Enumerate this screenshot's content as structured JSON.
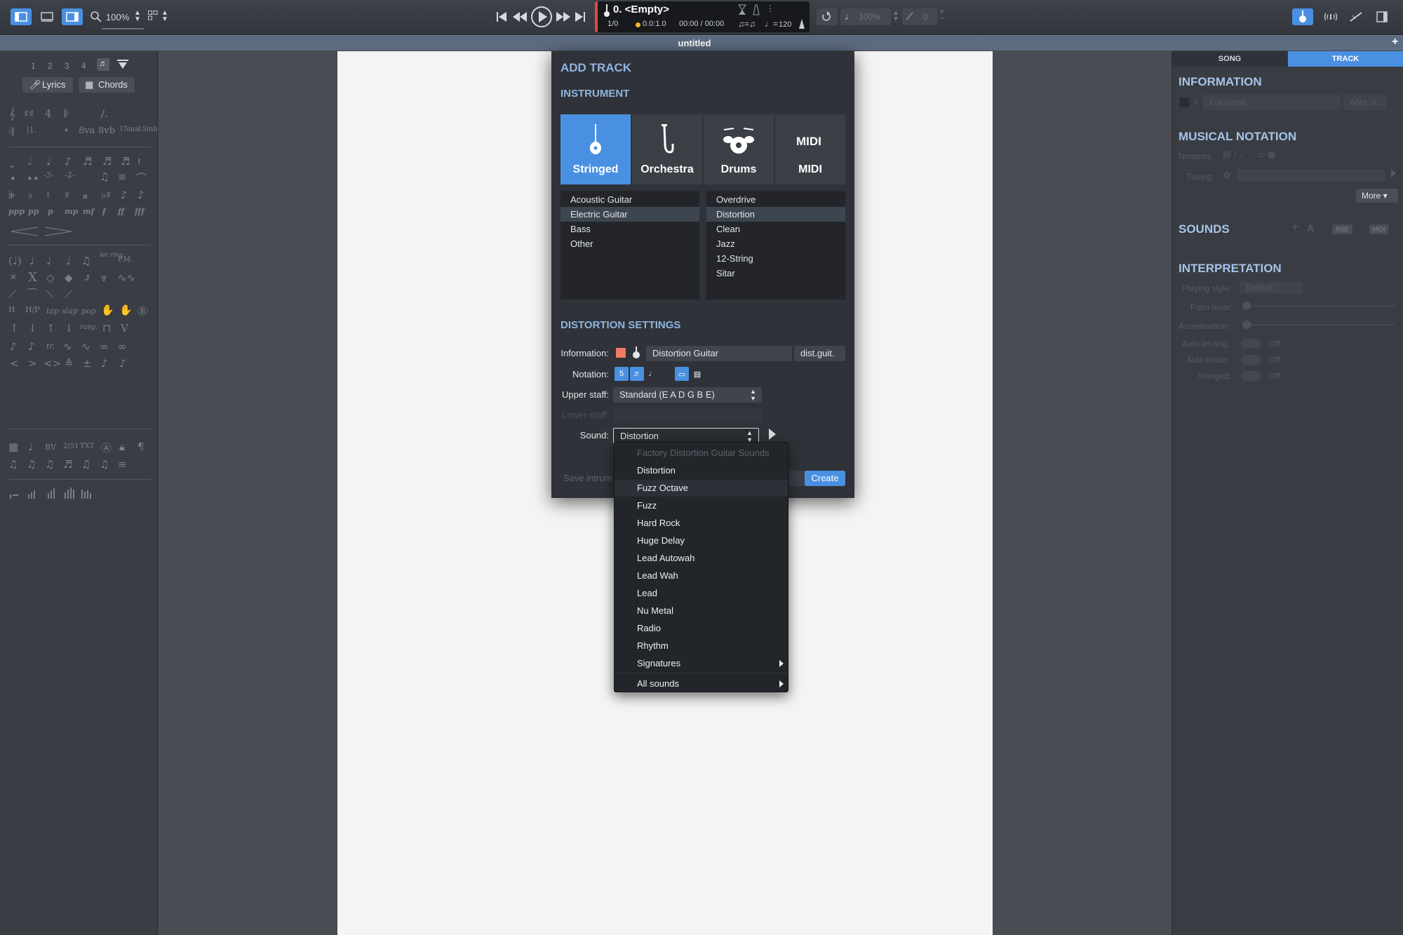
{
  "toolbar": {
    "zoom": "100%",
    "track_name": "0. <Empty>",
    "bar_position": "1/0",
    "beat_position": "0.0:1.0",
    "time": "00:00 / 00:00",
    "tempo": "120",
    "volume": "100%",
    "capo": "0"
  },
  "window_title": "untitled",
  "left_panel": {
    "voices": [
      "1",
      "2",
      "3",
      "4"
    ],
    "lyrics_label": "Lyrics",
    "chords_label": "Chords",
    "dynamics": [
      "ppp",
      "pp",
      "p",
      "mp",
      "mf",
      "f",
      "ff",
      "fff"
    ],
    "ottava": [
      "8va",
      "8vb",
      "15ma",
      "15mb"
    ],
    "techniques": [
      "tap",
      "slap",
      "pop",
      "P.M.",
      "let ring",
      "rasg.",
      "BV",
      "2/51",
      "TXT"
    ]
  },
  "right_panel": {
    "tabs": [
      "SONG",
      "TRACK"
    ],
    "active_tab": "TRACK",
    "information_title": "INFORMATION",
    "full_name_placeholder": "Full name",
    "abbr_placeholder": "Abbr. n...",
    "musical_notation_title": "MUSICAL NOTATION",
    "notation_label": "Notation:",
    "tuning_label": "Tuning:",
    "more_label": "More",
    "sounds_title": "SOUNDS",
    "sounds_badges": [
      "RSE",
      "MIDI"
    ],
    "interpretation_title": "INTERPRETATION",
    "interp_rows": [
      {
        "label": "Playing style:",
        "value": "Default"
      },
      {
        "label": "Palm mute:",
        "value": ""
      },
      {
        "label": "Accentuation:",
        "value": ""
      },
      {
        "label": "Auto let ring:",
        "value": "Off"
      },
      {
        "label": "Auto brush:",
        "value": "Off"
      },
      {
        "label": "Stringed:",
        "value": "Off"
      }
    ]
  },
  "dialog": {
    "title": "ADD TRACK",
    "instrument_heading": "INSTRUMENT",
    "categories": [
      "Stringed",
      "Orchestra",
      "Drums",
      "MIDI"
    ],
    "selected_category": "Stringed",
    "instruments": [
      "Acoustic Guitar",
      "Electric Guitar",
      "Bass",
      "Other"
    ],
    "selected_instrument": "Electric Guitar",
    "variants": [
      "Overdrive",
      "Distortion",
      "Clean",
      "Jazz",
      "12-String",
      "Sitar"
    ],
    "selected_variant": "Distortion",
    "settings_heading": "DISTORTION SETTINGS",
    "information_label": "Information:",
    "track_name": "Distortion Guitar",
    "track_abbr": "dist.guit.",
    "track_color": "#f07a63",
    "notation_label": "Notation:",
    "upper_staff_label": "Upper staff:",
    "upper_staff_value": "Standard (E A D G B E)",
    "lower_staff_label": "Lower staff:",
    "sound_label": "Sound:",
    "sound_value": "Distortion",
    "save_button": "Save intrum",
    "create_button": "Create"
  },
  "sound_menu": {
    "header": "Factory Distortion Guitar Sounds",
    "items": [
      "Distortion",
      "Fuzz Octave",
      "Fuzz",
      "Hard Rock",
      "Huge Delay",
      "Lead Autowah",
      "Lead Wah",
      "Lead",
      "Nu Metal",
      "Radio",
      "Rhythm",
      "Signatures"
    ],
    "all_sounds": "All sounds"
  },
  "colors": {
    "accent": "#4a90e2",
    "heading": "#8fb4e0",
    "record": "#e04a4a"
  }
}
